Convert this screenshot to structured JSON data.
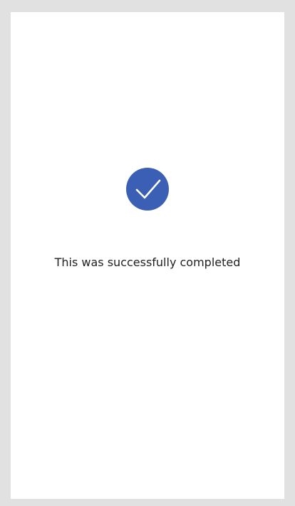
{
  "status": {
    "icon": "checkmark-icon",
    "message": "This was successfully completed"
  },
  "colors": {
    "accent": "#3a5fb5",
    "page_background": "#e1e1e1",
    "card_background": "#ffffff",
    "text": "#1f1f1f"
  }
}
